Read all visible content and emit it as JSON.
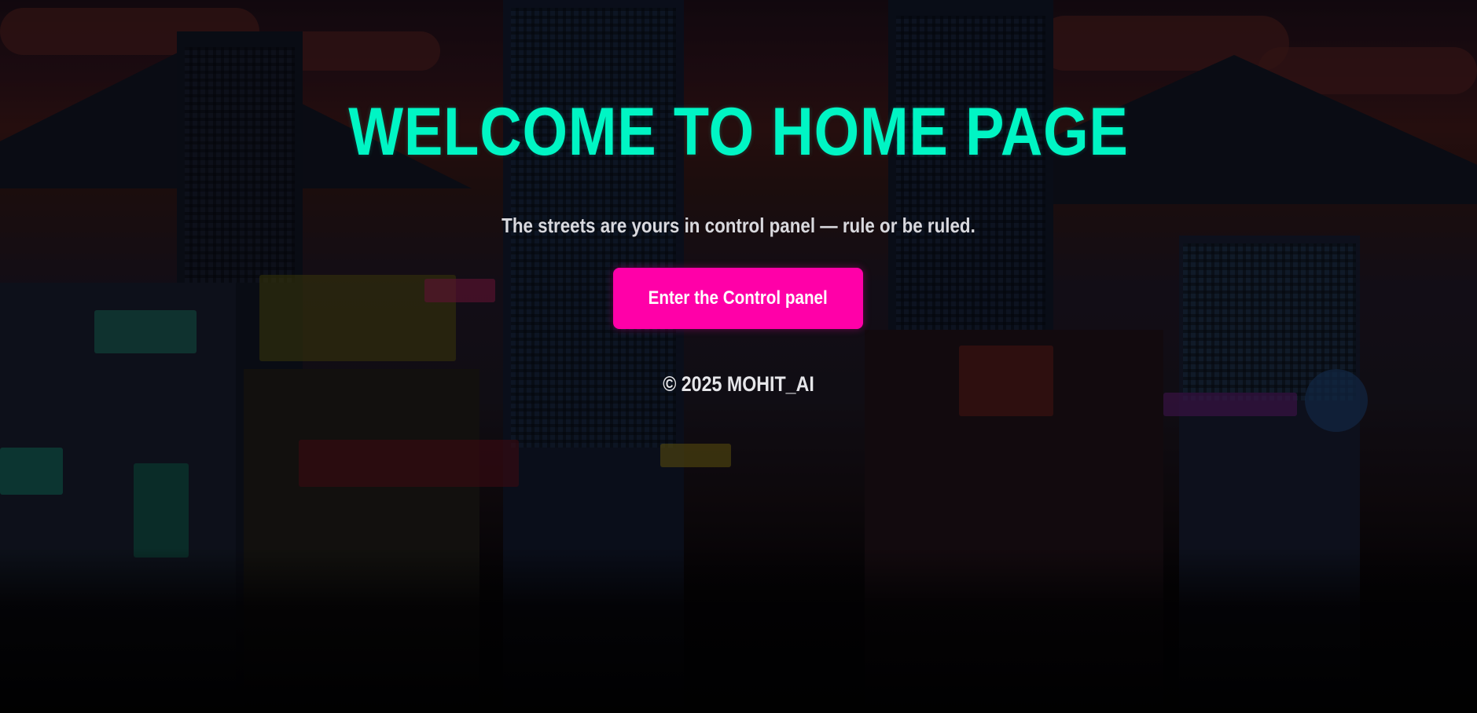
{
  "hero": {
    "title": "WELCOME TO HOME PAGE",
    "subtitle": "The streets are yours in control panel — rule or be ruled."
  },
  "actions": {
    "enter_label": "Enter the Control panel"
  },
  "footer": {
    "copyright": "© 2025 MOHIT_AI"
  },
  "colors": {
    "title": "#00f5c4",
    "button_bg": "#ff00a8",
    "button_text": "#ffffff",
    "body_text": "#d9d9de"
  },
  "background": {
    "description_icon": "pixel-cityscape-background"
  }
}
